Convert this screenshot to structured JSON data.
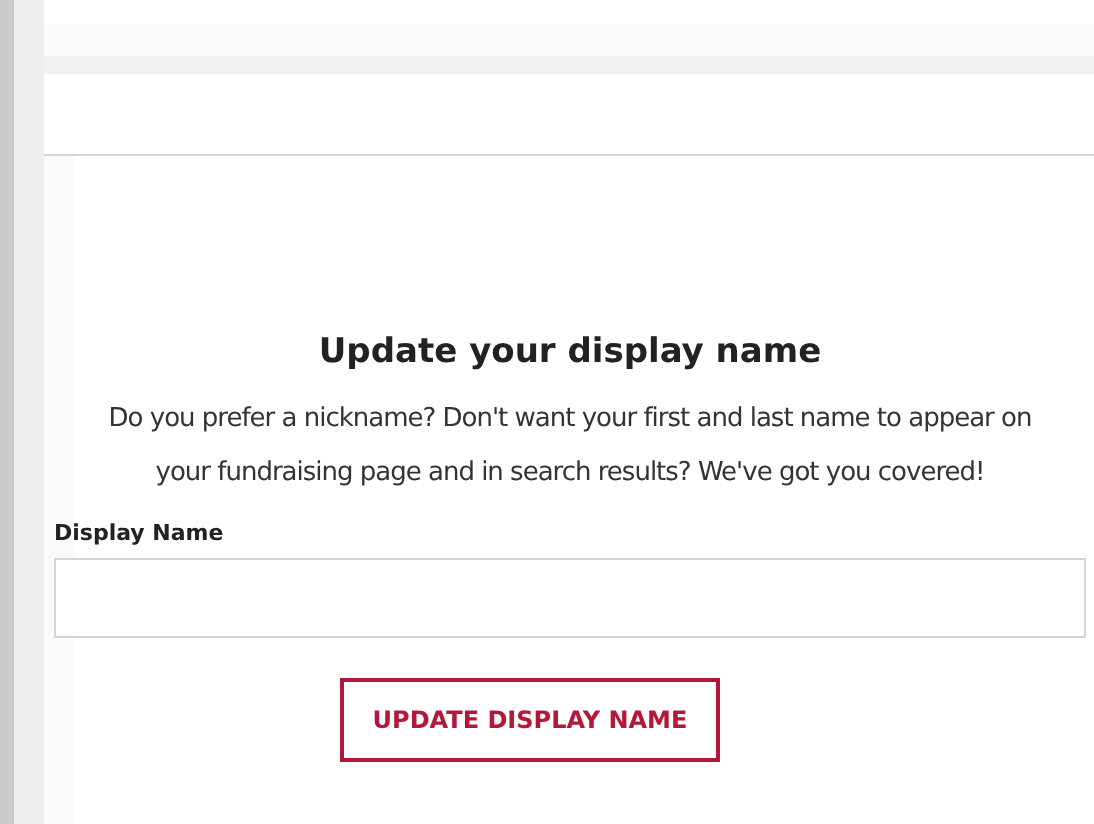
{
  "title": "Update your display name",
  "description": "Do you prefer a nickname? Don't want your first and last name to appear on your fundraising page and in search results? We've got you covered!",
  "field": {
    "label": "Display Name"
  },
  "button": "UPDATE DISPLAY NAME"
}
